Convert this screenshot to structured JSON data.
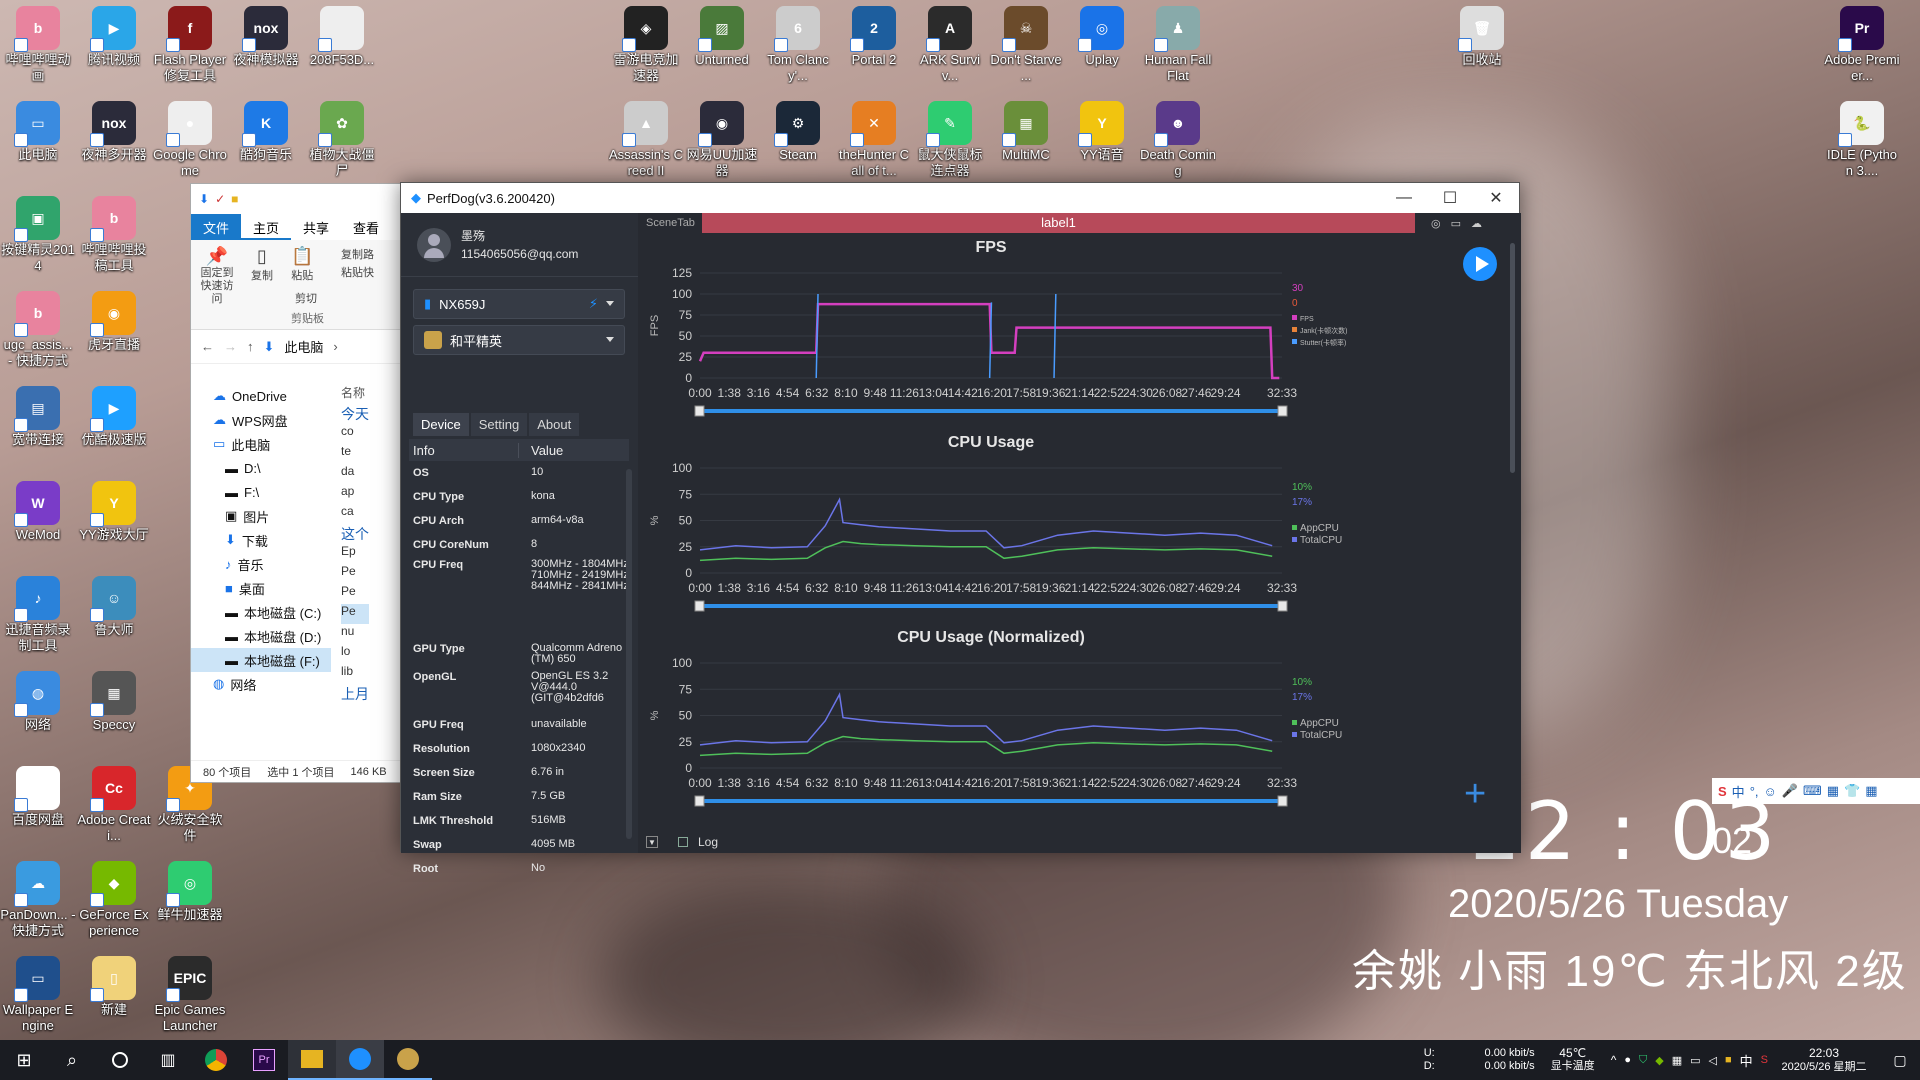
{
  "desktop_icons": [
    {
      "label": "哔哩哔哩动画",
      "color": "#e8839e",
      "glyph": "b"
    },
    {
      "label": "腾讯视频",
      "color": "#2aa6e8",
      "glyph": "▶"
    },
    {
      "label": "Flash Player修复工具",
      "color": "#8b1a1a",
      "glyph": "f"
    },
    {
      "label": "夜神模拟器",
      "color": "#2b2b3a",
      "glyph": "nox"
    },
    {
      "label": "208F53D...",
      "color": "#eeeeee",
      "glyph": ""
    },
    {
      "label": "此电脑",
      "color": "#3a8be0",
      "glyph": "▭"
    },
    {
      "label": "夜神多开器",
      "color": "#2b2b3a",
      "glyph": "nox"
    },
    {
      "label": "Google Chrome",
      "color": "#eeeeee",
      "glyph": "●"
    },
    {
      "label": "酷狗音乐",
      "color": "#1e7ae6",
      "glyph": "K"
    },
    {
      "label": "植物大战僵尸",
      "color": "#6aa84f",
      "glyph": "✿"
    },
    {
      "label": "按键精灵2014",
      "color": "#30a46c",
      "glyph": "▣"
    },
    {
      "label": "哔哩哔哩投稿工具",
      "color": "#e8839e",
      "glyph": "b"
    },
    {
      "label": "ugc_assis... - 快捷方式",
      "color": "#e8839e",
      "glyph": "b"
    },
    {
      "label": "虎牙直播",
      "color": "#f39c12",
      "glyph": "◉"
    },
    {
      "label": "宽带连接",
      "color": "#3a6fb0",
      "glyph": "▤"
    },
    {
      "label": "优酷极速版",
      "color": "#1ea0ff",
      "glyph": "▶"
    },
    {
      "label": "WeMod",
      "color": "#7a3cc8",
      "glyph": "W"
    },
    {
      "label": "YY游戏大厅",
      "color": "#f1c40f",
      "glyph": "Y"
    },
    {
      "label": "迅捷音频录制工具",
      "color": "#2a82da",
      "glyph": "♪"
    },
    {
      "label": "鲁大师",
      "color": "#3c8dbc",
      "glyph": "☺"
    },
    {
      "label": "网络",
      "color": "#3a8be0",
      "glyph": "◍"
    },
    {
      "label": "Speccy",
      "color": "#555555",
      "glyph": "▦"
    },
    {
      "label": "百度网盘",
      "color": "#ffffff",
      "glyph": "☁"
    },
    {
      "label": "Adobe Creati...",
      "color": "#d8262b",
      "glyph": "Cc"
    },
    {
      "label": "火绒安全软件",
      "color": "#f39c12",
      "glyph": "✦"
    },
    {
      "label": "PanDown... - 快捷方式",
      "color": "#3a9be0",
      "glyph": "☁"
    },
    {
      "label": "GeForce Experience",
      "color": "#76b900",
      "glyph": "◆"
    },
    {
      "label": "鲜牛加速器",
      "color": "#2ecc71",
      "glyph": "◎"
    },
    {
      "label": "Wallpaper Engine",
      "color": "#1f4f8c",
      "glyph": "▭"
    },
    {
      "label": "新建",
      "color": "#f0d27a",
      "glyph": "▯"
    },
    {
      "label": "Epic Games Launcher",
      "color": "#2b2b2b",
      "glyph": "EPIC"
    },
    {
      "label": "雷游电竞加速器",
      "color": "#222222",
      "glyph": "◈"
    },
    {
      "label": "Unturned",
      "color": "#4a7a3a",
      "glyph": "▨"
    },
    {
      "label": "Tom Clancy'...",
      "color": "#cccccc",
      "glyph": "6"
    },
    {
      "label": "Portal 2",
      "color": "#1d5e9e",
      "glyph": "2"
    },
    {
      "label": "ARK Surviv...",
      "color": "#2b2b2b",
      "glyph": "A"
    },
    {
      "label": "Don't Starve ...",
      "color": "#6b4b2b",
      "glyph": "☠"
    },
    {
      "label": "Uplay",
      "color": "#1a73e8",
      "glyph": "◎"
    },
    {
      "label": "Human Fall Flat",
      "color": "#8aa",
      "glyph": "♟"
    },
    {
      "label": "Assassin's Creed II",
      "color": "#cccccc",
      "glyph": "▲"
    },
    {
      "label": "网易UU加速器",
      "color": "#2b2b3a",
      "glyph": "◉"
    },
    {
      "label": "Steam",
      "color": "#1b2838",
      "glyph": "⚙"
    },
    {
      "label": "theHunter Call of t...",
      "color": "#e67e22",
      "glyph": "✕"
    },
    {
      "label": "鼠大侠鼠标连点器",
      "color": "#2ecc71",
      "glyph": "✎"
    },
    {
      "label": "MultiMC",
      "color": "#6a8f3a",
      "glyph": "▦"
    },
    {
      "label": "YY语音",
      "color": "#f1c40f",
      "glyph": "Y"
    },
    {
      "label": "Death Coming",
      "color": "#5a3a8a",
      "glyph": "☻"
    },
    {
      "label": "回收站",
      "color": "#dddddd",
      "glyph": "🗑"
    },
    {
      "label": "Adobe Premier...",
      "color": "#2a0a4a",
      "glyph": "Pr"
    },
    {
      "label": "IDLE (Python 3....",
      "color": "#f1f1f1",
      "glyph": "🐍"
    }
  ],
  "explorer": {
    "tabs": [
      "文件",
      "主页",
      "共享",
      "查看"
    ],
    "ribbon": {
      "pin": "固定到快速访问",
      "copy": "复制",
      "paste": "粘贴",
      "copy_path": "复制路",
      "paste_shortcut": "粘贴快",
      "cut": "剪切",
      "clipboard": "剪贴板"
    },
    "breadcrumb": "此电脑",
    "tree": [
      "OneDrive",
      "WPS网盘",
      "此电脑",
      "D:\\",
      "F:\\",
      "图片",
      "下载",
      "音乐",
      "桌面",
      "本地磁盘 (C:)",
      "本地磁盘 (D:)",
      "本地磁盘 (F:)",
      "网络"
    ],
    "col_header": "名称",
    "group_today": "今天",
    "group_this": "这个",
    "group_last": "上月",
    "list": [
      "co",
      "te",
      "da",
      "ap",
      "ca",
      "Ep",
      "Pe",
      "Pe",
      "Pe",
      "nu",
      "lo",
      "lib"
    ],
    "status": {
      "count": "80 个项目",
      "selected": "选中 1 个项目",
      "size": "146 KB"
    }
  },
  "perfdog": {
    "title": "PerfDog(v3.6.200420)",
    "user": {
      "name": "墨殇",
      "email": "1154065056@qq.com"
    },
    "device": "NX659J",
    "app": "和平精英",
    "tabs": [
      "Device",
      "Setting",
      "About"
    ],
    "info_header": {
      "k": "Info",
      "v": "Value"
    },
    "info_rows": [
      {
        "k": "OS",
        "v": "10"
      },
      {
        "k": "CPU Type",
        "v": "kona"
      },
      {
        "k": "CPU Arch",
        "v": "arm64-v8a"
      },
      {
        "k": "CPU CoreNum",
        "v": "8"
      },
      {
        "k": "CPU Freq",
        "v": "300MHz - 1804MHz 710MHz - 2419MHz 844MHz - 2841MHz"
      },
      {
        "k": "GPU Type",
        "v": "Qualcomm Adreno (TM) 650"
      },
      {
        "k": "OpenGL",
        "v": "OpenGL ES 3.2 V@444.0 (GIT@4b2dfd6"
      },
      {
        "k": "GPU Freq",
        "v": "unavailable"
      },
      {
        "k": "Resolution",
        "v": "1080x2340"
      },
      {
        "k": "Screen Size",
        "v": "6.76 in"
      },
      {
        "k": "Ram Size",
        "v": "7.5 GB"
      },
      {
        "k": "LMK Threshold",
        "v": "516MB"
      },
      {
        "k": "Swap",
        "v": "4095 MB"
      },
      {
        "k": "Root",
        "v": "No"
      }
    ],
    "scene_tab": "SceneTab",
    "label": "label1",
    "log": "Log",
    "accent_red": "#b74a5a",
    "accent_blue": "#1e90ff"
  },
  "chart_data": [
    {
      "type": "line",
      "title": "FPS",
      "ylabel": "FPS",
      "ylim": [
        0,
        125
      ],
      "yticks": [
        0,
        25,
        50,
        75,
        100,
        125
      ],
      "xticks": [
        "0:00",
        "1:38",
        "3:16",
        "4:54",
        "6:32",
        "8:10",
        "9:48",
        "11:26",
        "13:04",
        "14:42",
        "16:20",
        "17:58",
        "19:36",
        "21:14",
        "22:52",
        "24:30",
        "26:08",
        "27:46",
        "29:24",
        "32:33"
      ],
      "legend": [
        "FPS",
        "Jank(卡顿次数)",
        "Stutter(卡顿率)"
      ],
      "legend_values": [
        "30",
        "0"
      ],
      "series": [
        {
          "name": "FPS",
          "color": "#d43fbf",
          "x": [
            0,
            0.2,
            1.2,
            3.0,
            5.6,
            6.5,
            6.6,
            9.0,
            12.0,
            15.0,
            16.2,
            16.3,
            17.6,
            17.7,
            19.0,
            21.0,
            24.0,
            27.0,
            30.0,
            31.9,
            32.0,
            32.4
          ],
          "y": [
            20,
            30,
            30,
            30,
            30,
            30,
            88,
            88,
            88,
            88,
            88,
            30,
            30,
            60,
            60,
            60,
            60,
            60,
            60,
            60,
            0,
            0
          ]
        },
        {
          "name": "Stutter(卡顿率)",
          "color": "#4a9cff",
          "x": [
            6.5,
            6.6,
            16.2,
            16.3,
            19.8,
            19.9
          ],
          "y": [
            0,
            100,
            0,
            90,
            0,
            100
          ]
        }
      ]
    },
    {
      "type": "line",
      "title": "CPU Usage",
      "ylabel": "%",
      "ylim": [
        0,
        100
      ],
      "yticks": [
        0,
        25,
        50,
        75,
        100
      ],
      "xticks": [
        "0:00",
        "1:38",
        "3:16",
        "4:54",
        "6:32",
        "8:10",
        "9:48",
        "11:26",
        "13:04",
        "14:42",
        "16:20",
        "17:58",
        "19:36",
        "21:14",
        "22:52",
        "24:30",
        "26:08",
        "27:46",
        "29:24",
        "32:33"
      ],
      "legend": [
        "AppCPU",
        "TotalCPU"
      ],
      "legend_values": [
        "10%",
        "17%"
      ],
      "series": [
        {
          "name": "AppCPU",
          "color": "#4fc05a",
          "x": [
            0,
            2,
            4,
            6,
            7,
            8,
            9,
            10,
            12,
            14,
            16,
            17,
            18,
            20,
            22,
            24,
            26,
            28,
            30,
            32
          ],
          "y": [
            12,
            14,
            13,
            14,
            24,
            30,
            28,
            27,
            26,
            25,
            25,
            14,
            16,
            22,
            24,
            23,
            22,
            23,
            22,
            16
          ]
        },
        {
          "name": "TotalCPU",
          "color": "#6b75e8",
          "x": [
            0,
            2,
            4,
            6,
            7,
            7.8,
            8,
            9,
            10,
            12,
            14,
            16,
            17,
            18,
            20,
            22,
            24,
            26,
            28,
            30,
            32
          ],
          "y": [
            22,
            26,
            24,
            25,
            45,
            70,
            48,
            46,
            44,
            42,
            40,
            40,
            24,
            26,
            36,
            40,
            38,
            36,
            38,
            36,
            26
          ]
        }
      ]
    },
    {
      "type": "line",
      "title": "CPU Usage (Normalized)",
      "ylabel": "%",
      "ylim": [
        0,
        100
      ],
      "yticks": [
        0,
        25,
        50,
        75,
        100
      ],
      "xticks": [
        "0:00",
        "1:38",
        "3:16",
        "4:54",
        "6:32",
        "8:10",
        "9:48",
        "11:26",
        "13:04",
        "14:42",
        "16:20",
        "17:58",
        "19:36",
        "21:14",
        "22:52",
        "24:30",
        "26:08",
        "27:46",
        "29:24",
        "32:33"
      ],
      "legend": [
        "AppCPU",
        "TotalCPU"
      ],
      "legend_values": [
        "10%",
        "17%"
      ],
      "series": [
        {
          "name": "AppCPU",
          "color": "#4fc05a",
          "x": [
            0,
            2,
            4,
            6,
            7,
            8,
            9,
            10,
            12,
            14,
            16,
            17,
            18,
            20,
            22,
            24,
            26,
            28,
            30,
            32
          ],
          "y": [
            12,
            14,
            13,
            14,
            24,
            30,
            28,
            27,
            26,
            25,
            25,
            14,
            16,
            22,
            24,
            23,
            22,
            23,
            22,
            16
          ]
        },
        {
          "name": "TotalCPU",
          "color": "#6b75e8",
          "x": [
            0,
            2,
            4,
            6,
            7,
            7.8,
            8,
            9,
            10,
            12,
            14,
            16,
            17,
            18,
            20,
            22,
            24,
            26,
            28,
            30,
            32
          ],
          "y": [
            22,
            26,
            24,
            25,
            45,
            70,
            48,
            46,
            44,
            42,
            40,
            40,
            24,
            26,
            36,
            40,
            38,
            36,
            38,
            36,
            26
          ]
        }
      ]
    }
  ],
  "clock": {
    "time": "22 : 03",
    "seconds": "02",
    "date": "2020/5/26 Tuesday",
    "weather": "余姚 小雨 19℃ 东北风 2级"
  },
  "taskbar": {
    "net_up": "0.00 kbit/s",
    "net_down": "0.00 kbit/s",
    "u": "U:",
    "d": "D:",
    "temp": "45℃",
    "temp_label": "显卡温度",
    "ime": "中",
    "tray_time": "22:03",
    "tray_date": "2020/5/26 星期二"
  }
}
